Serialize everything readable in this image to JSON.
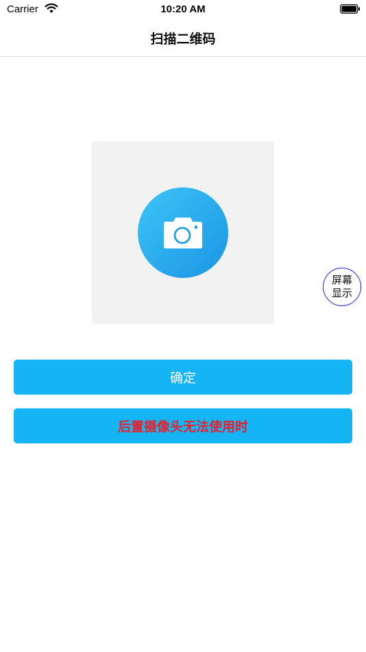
{
  "status_bar": {
    "carrier": "Carrier",
    "time": "10:20 AM",
    "wifi_icon": "wifi-icon",
    "battery_icon": "battery-icon"
  },
  "nav": {
    "title": "扫描二维码"
  },
  "camera": {
    "icon": "camera-icon",
    "accent_color": "#1a95e4"
  },
  "floating_button": {
    "line1": "屏幕",
    "line2": "显示",
    "border_color": "#1a1aff"
  },
  "buttons": {
    "confirm_label": "确定",
    "rear_camera_label": "后置摄像头无法使用时",
    "background_color": "#14b4f5",
    "rear_label_color": "#e8202a"
  }
}
